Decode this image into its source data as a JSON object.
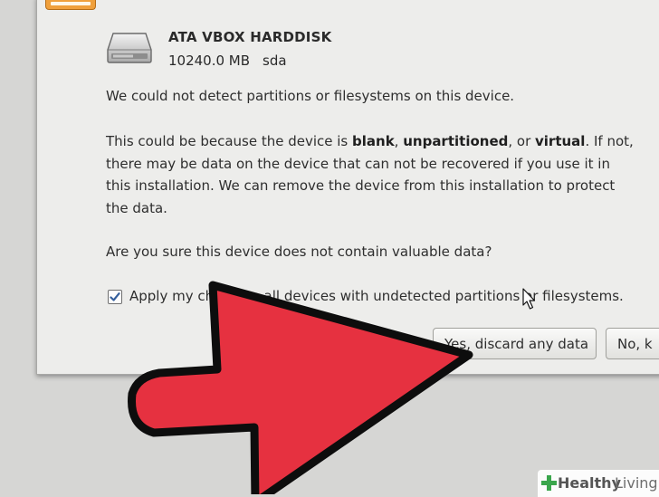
{
  "device": {
    "name": "ATA VBOX HARDDISK",
    "size": "10240.0 MB",
    "node": "sda"
  },
  "message": {
    "line1": "We could not detect partitions or filesystems on this device.",
    "p2_a": "This could be because the device is ",
    "p2_blank": "blank",
    "p2_sep1": ", ",
    "p2_unpartitioned": "unpartitioned",
    "p2_sep2": ", or ",
    "p2_virtual": "virtual",
    "p2_b": ". If not,",
    "p2_line2": "there may be data on the device that can not be recovered if you use it in",
    "p2_line3": "this installation. We can remove the device from this installation to protect",
    "p2_line4": "the data.",
    "question": "Are you sure this device does not contain valuable data?"
  },
  "checkbox": {
    "label": "Apply my choice to all devices with undetected partitions or filesystems.",
    "checked": true
  },
  "buttons": {
    "yes": "Yes, discard any data",
    "no": "No, k"
  },
  "watermark": {
    "brand_a": "Healthy",
    "brand_b": "Living"
  },
  "colors": {
    "arrow": "#e63140",
    "warning": "#f0a03c",
    "watermark_plus": "#3aa64c"
  }
}
